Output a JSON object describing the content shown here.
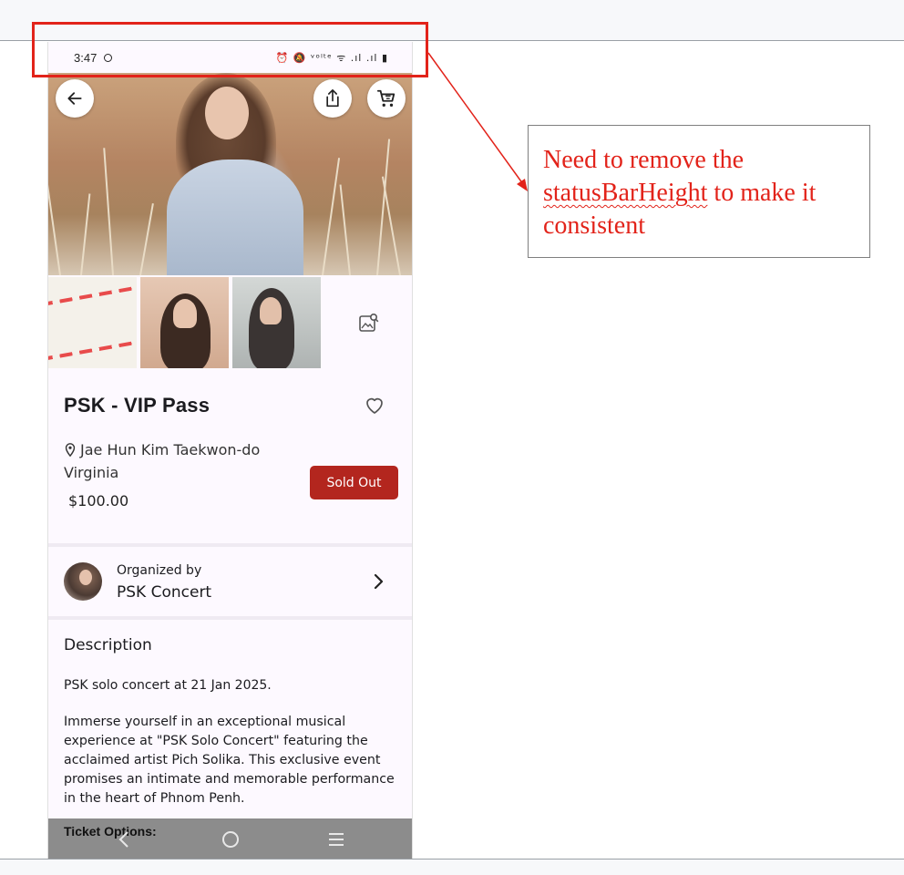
{
  "status_bar": {
    "time": "3:47",
    "right_icons": "⏰ 🔕 ᵛᵒˡᵗᵉ ᯤ .ıl .ıl ▮"
  },
  "hero": {
    "back_icon": "arrow-left-icon",
    "share_icon": "share-icon",
    "cart_icon": "shopping-cart-icon"
  },
  "thumbnails": {
    "add_icon": "image-search-icon"
  },
  "event": {
    "title": "PSK - VIP Pass",
    "location_line1": "Jae Hun Kim Taekwon-do",
    "location_line2": "Virginia",
    "price": "$100.00",
    "status_button": "Sold Out"
  },
  "organizer": {
    "label": "Organized by",
    "name": "PSK Concert"
  },
  "description": {
    "heading": "Description",
    "paragraph1": "PSK solo concert at 21 Jan 2025.",
    "paragraph2": "Immerse yourself in an exceptional musical experience at \"PSK Solo Concert\" featuring the acclaimed artist Pich Solika. This exclusive event promises an intimate and memorable performance in the heart of Phnom Penh."
  },
  "ticket_options": {
    "label": "Ticket Options:"
  },
  "annotation": {
    "note_part1": "Need to remove the",
    "note_keyword": "statusBarHeight",
    "note_part2": "to make it consistent",
    "color": "#e2231a"
  },
  "colors": {
    "sold_out_bg": "#b3261e",
    "screen_bg": "#fdf9ff"
  }
}
